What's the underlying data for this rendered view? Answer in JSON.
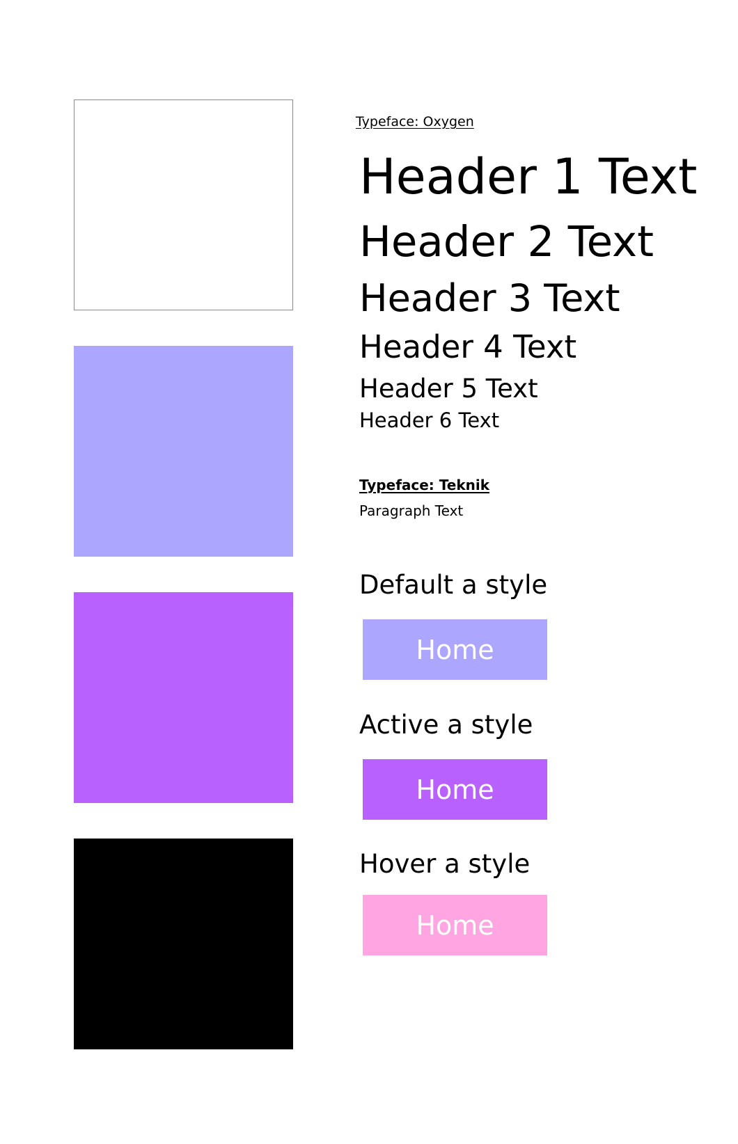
{
  "palette": [
    {
      "name": "white",
      "color": "#ffffff",
      "border": "#8a8a8a"
    },
    {
      "name": "lavender",
      "color": "#ada6ff"
    },
    {
      "name": "purple",
      "color": "#b961ff"
    },
    {
      "name": "black",
      "color": "#000000"
    }
  ],
  "typography": {
    "oxygen_label": "Typeface: Oxygen",
    "headers": [
      "Header 1 Text",
      "Header 2 Text",
      "Header 3 Text",
      "Header 4 Text",
      "Header 5 Text",
      "Header 6 Text"
    ],
    "teknik_label": "Typeface: Teknik",
    "paragraph": "Paragraph Text"
  },
  "link_styles": {
    "default": {
      "label": "Default a style",
      "button_text": "Home",
      "bg": "#ada6ff",
      "text_color": "#ffffff"
    },
    "active": {
      "label": "Active a style",
      "button_text": "Home",
      "bg": "#b961ff",
      "text_color": "#ffffff"
    },
    "hover": {
      "label": "Hover a style",
      "button_text": "Home",
      "bg": "#ffa6e2",
      "text_color": "#ffffff"
    }
  }
}
